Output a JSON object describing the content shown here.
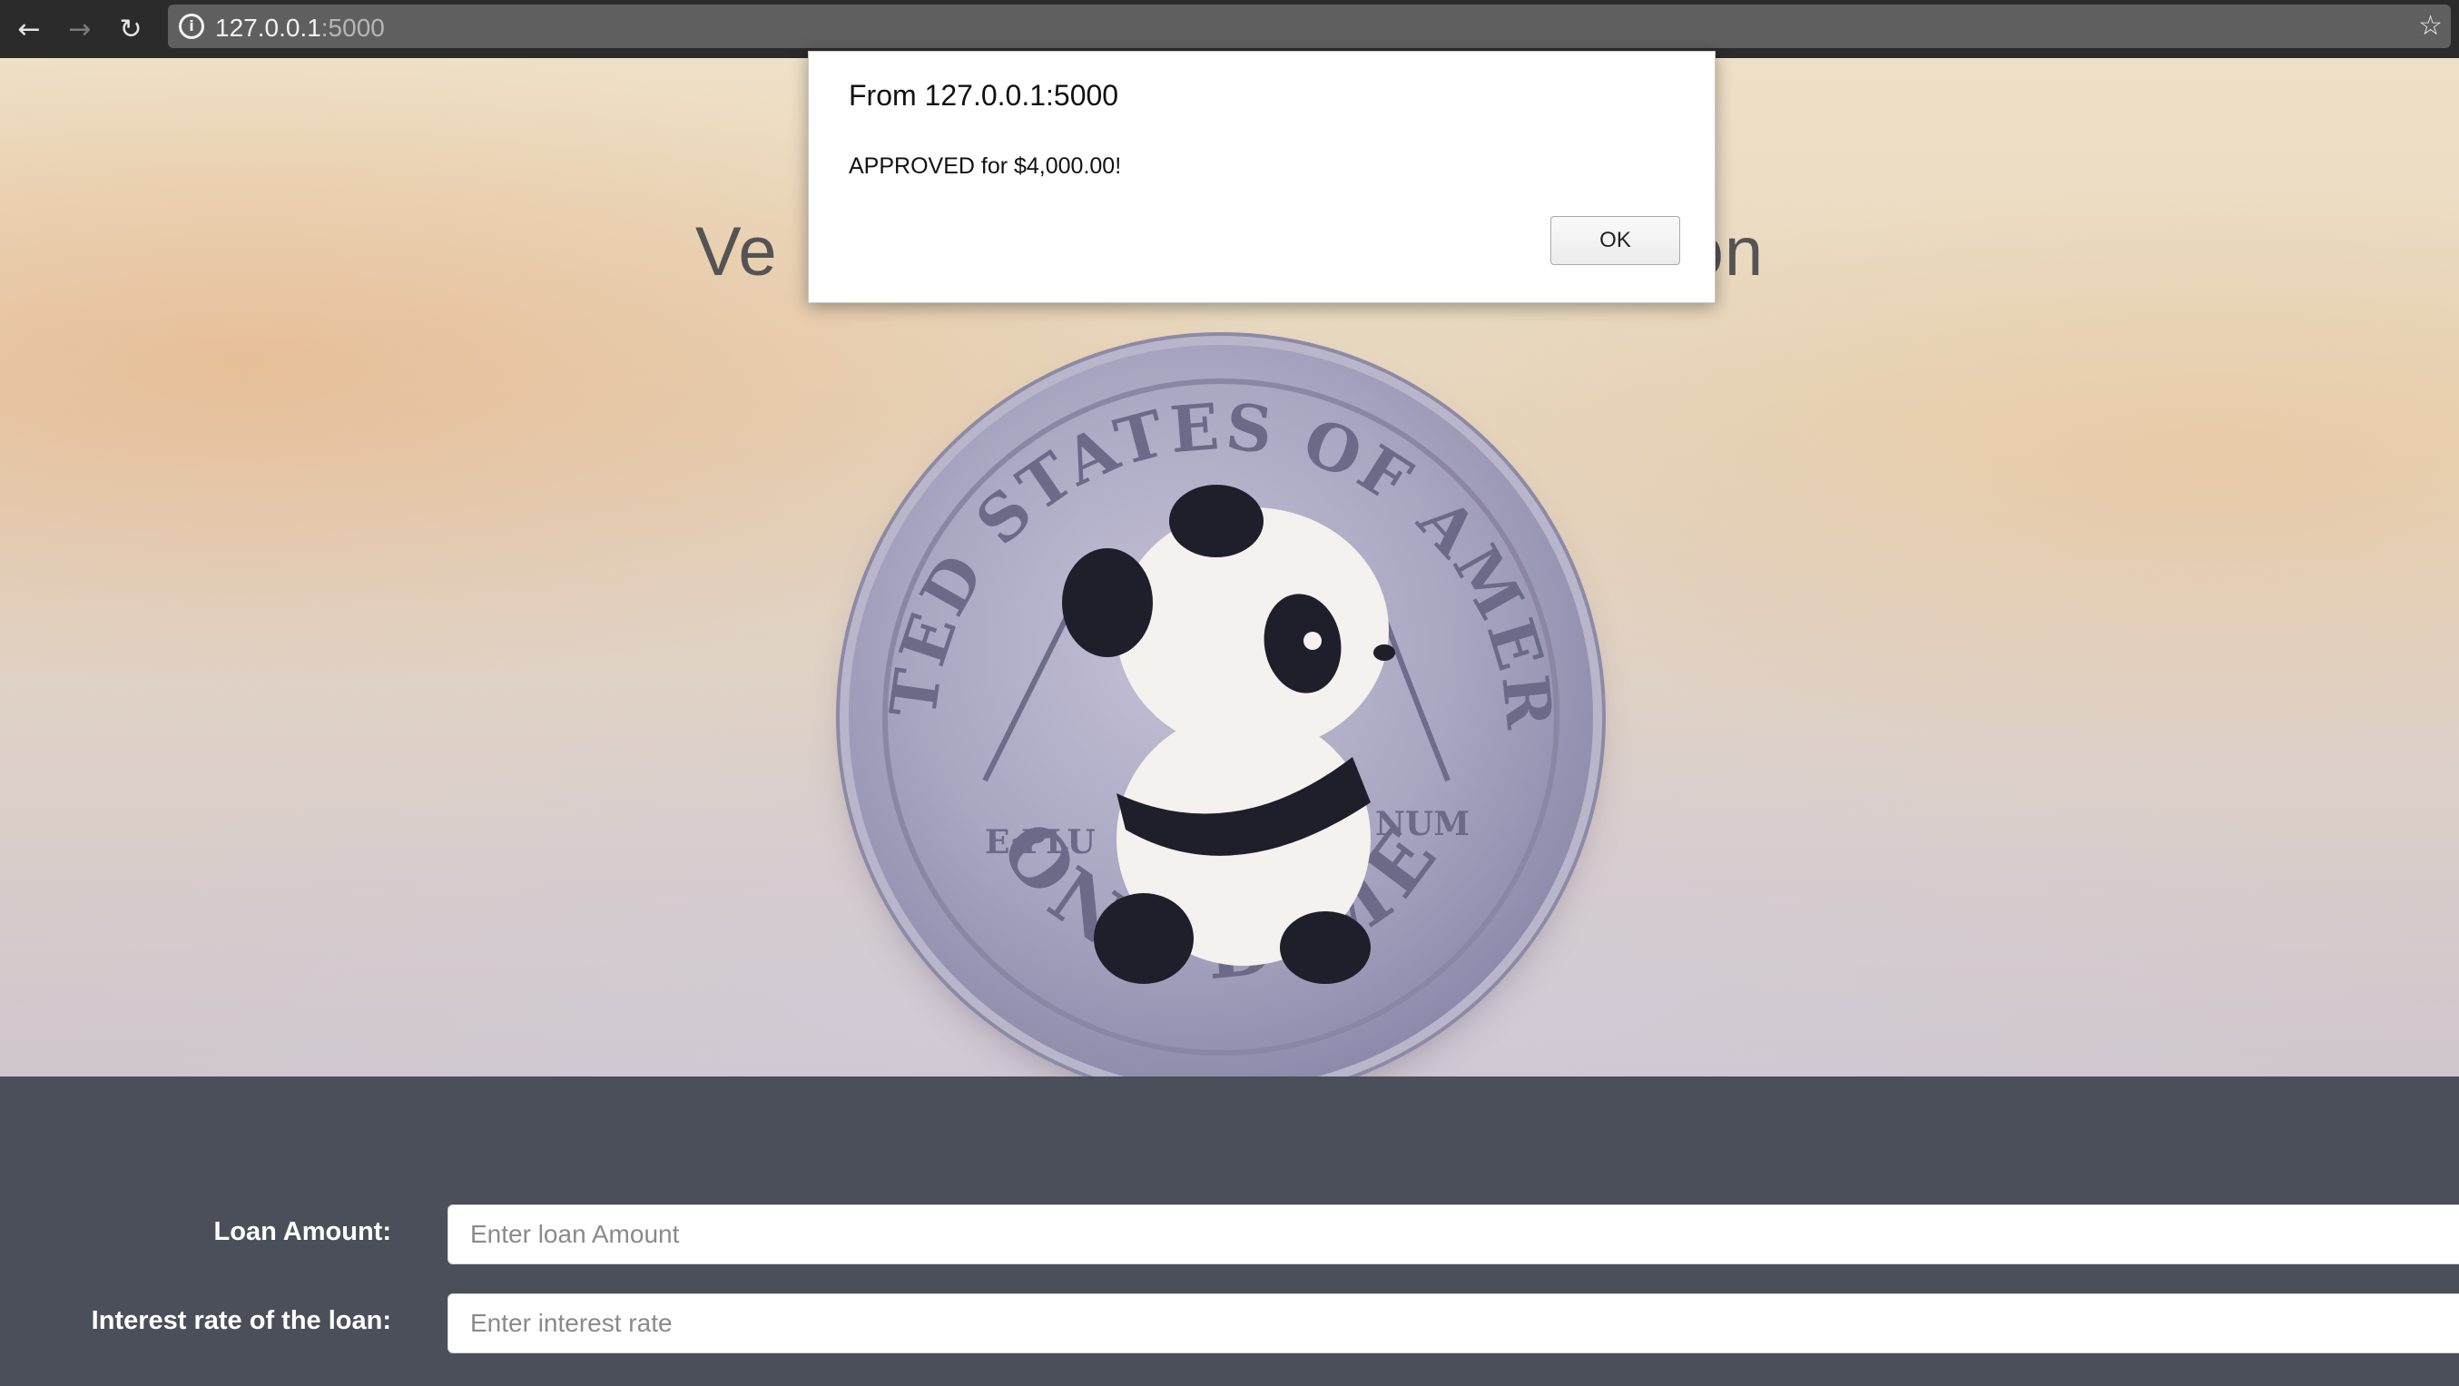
{
  "browser": {
    "back_icon": "←",
    "forward_icon": "→",
    "reload_icon": "↻",
    "info_icon": "i",
    "url_host": "127.0.0.1",
    "url_port": ":5000",
    "bookmark_icon": "☆"
  },
  "hero": {
    "title_left": "Ve",
    "title_right": "on",
    "coin": {
      "top_text": "UNITED STATES OF AMERICA",
      "bottom_text": "ONE DIME",
      "left_motto": "E·PLU",
      "right_motto": "NUM"
    }
  },
  "form": {
    "loan_amount_label": "Loan Amount:",
    "loan_amount_placeholder": "Enter loan Amount",
    "interest_rate_label": "Interest rate of the loan:",
    "interest_rate_placeholder": "Enter interest rate"
  },
  "alert": {
    "origin": "From 127.0.0.1:5000",
    "message": "APPROVED for $4,000.00!",
    "ok_label": "OK"
  },
  "colors": {
    "form_bg": "#4b4f59",
    "chrome_bg": "#2b2b2b",
    "omnibox_bg": "#5f5f5f"
  }
}
